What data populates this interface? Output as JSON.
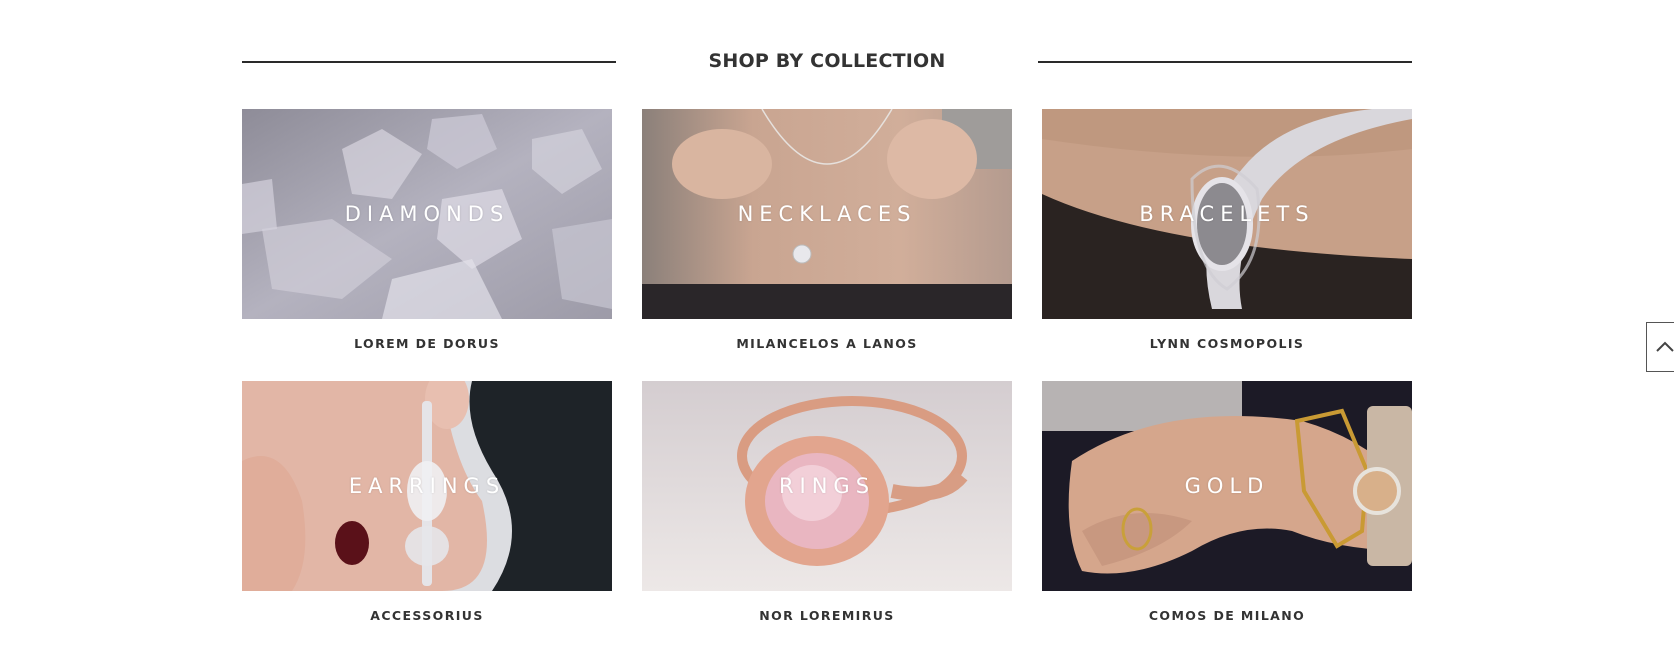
{
  "section": {
    "title": "SHOP BY COLLECTION"
  },
  "collections": [
    {
      "overlay": "DIAMONDS",
      "caption": "LOREM DE DORUS"
    },
    {
      "overlay": "NECKLACES",
      "caption": "MILANCELOS A LANOS"
    },
    {
      "overlay": "BRACELETS",
      "caption": "LYNN COSMOPOLIS"
    },
    {
      "overlay": "EARRINGS",
      "caption": "ACCESSORIUS"
    },
    {
      "overlay": "RINGS",
      "caption": "NOR LOREMIRUS"
    },
    {
      "overlay": "GOLD",
      "caption": "COMOS DE MILANO"
    }
  ],
  "icons": {
    "back_to_top": "chevron-up-icon"
  },
  "colors": {
    "heading": "#333333",
    "rule": "#2a2a2a",
    "overlay_text": "#ffffff"
  }
}
